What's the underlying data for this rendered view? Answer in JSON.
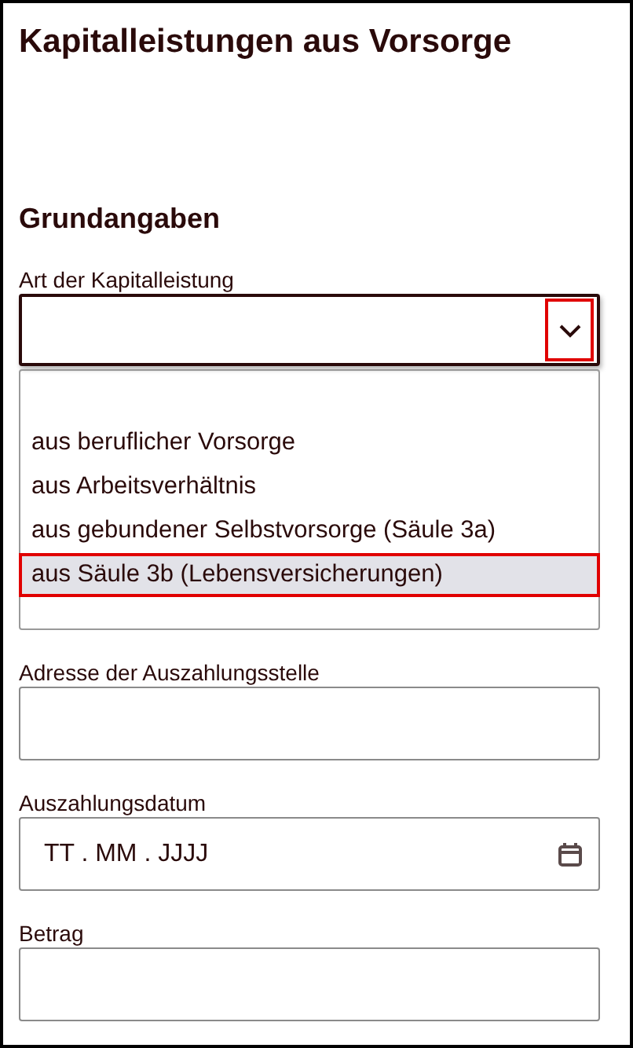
{
  "title": "Kapitalleistungen aus Vorsorge",
  "section": "Grundangaben",
  "select": {
    "label": "Art der Kapitalleistung",
    "expanded": true,
    "toggle_highlighted": true,
    "options": [
      {
        "label": "aus beruflicher Vorsorge",
        "selected": false
      },
      {
        "label": "aus Arbeitsverhältnis",
        "selected": false
      },
      {
        "label": "aus gebundener Selbstvorsorge (Säule 3a)",
        "selected": false
      },
      {
        "label": "aus Säule 3b (Lebensversicherungen)",
        "selected": true
      }
    ]
  },
  "fields": [
    {
      "kind": "text",
      "label": "Adresse der Auszahlungsstelle"
    },
    {
      "kind": "date",
      "label": "Auszahlungsdatum",
      "placeholder": "TT . MM . JJJJ"
    },
    {
      "kind": "text",
      "label": "Betrag"
    }
  ]
}
